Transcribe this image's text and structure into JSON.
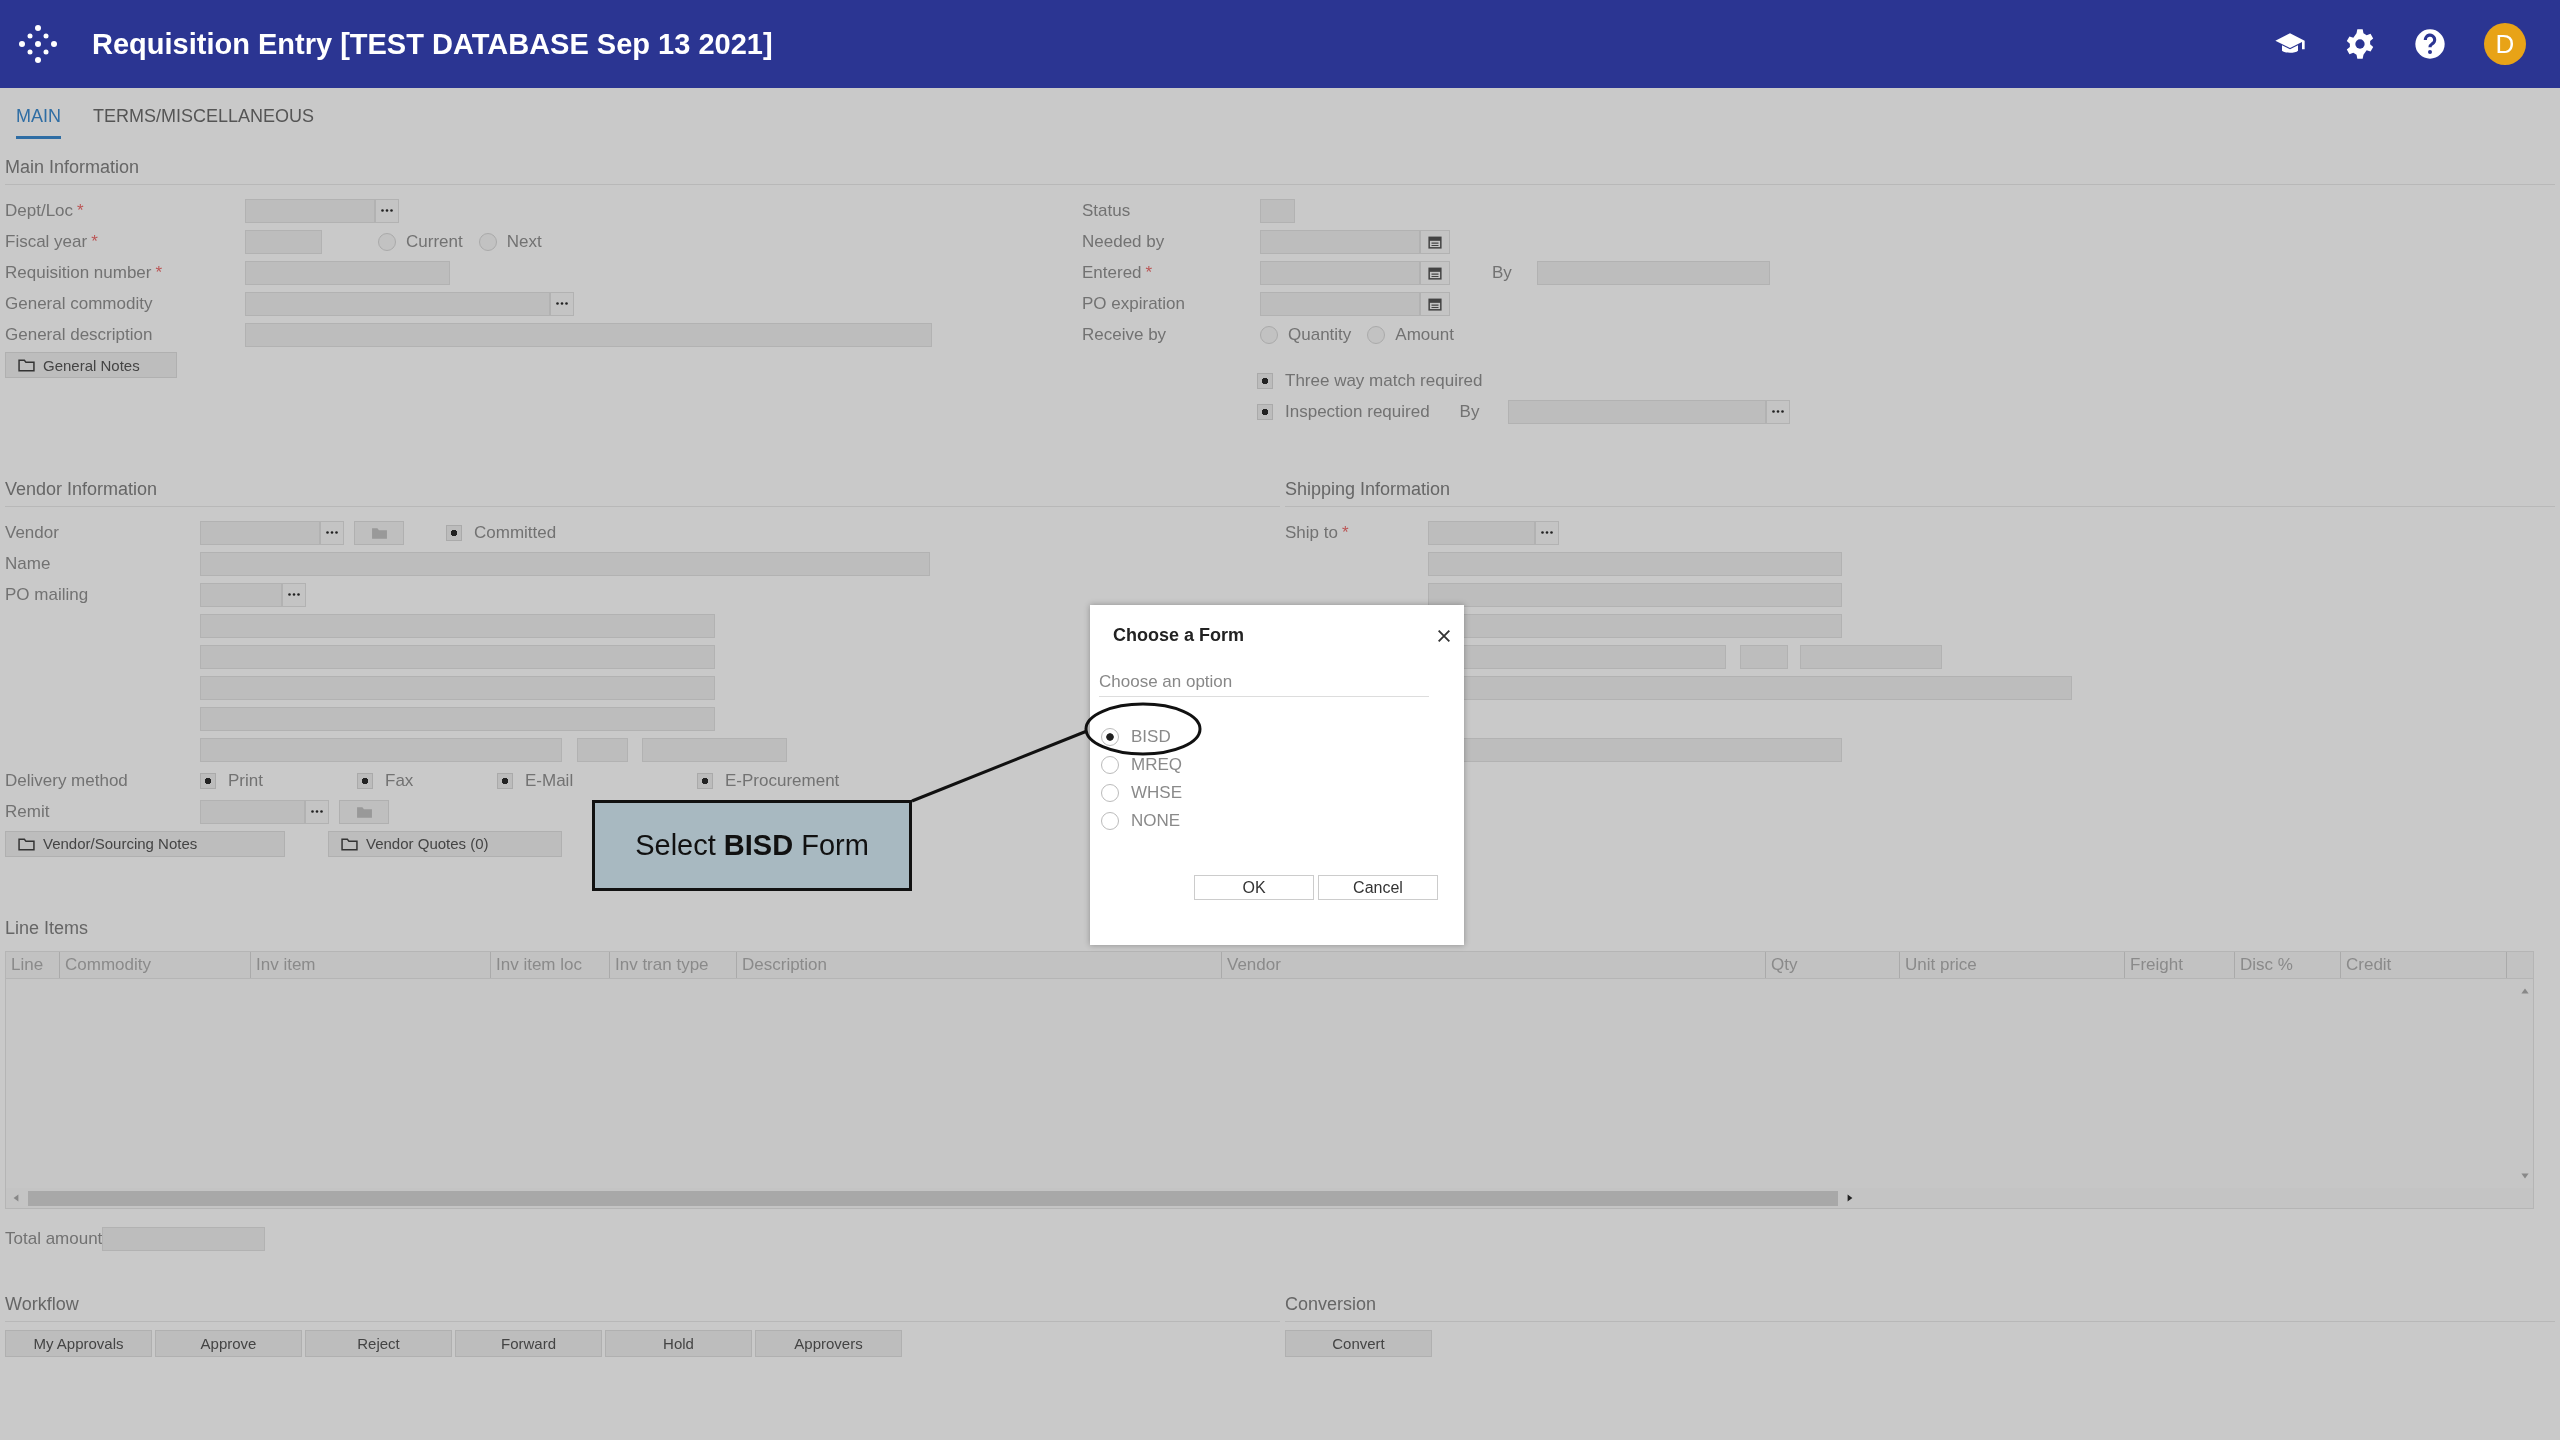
{
  "header": {
    "title": "Requisition Entry [TEST DATABASE Sep 13 2021]",
    "user_initial": "D"
  },
  "tabs": [
    {
      "label": "MAIN",
      "selected": true
    },
    {
      "label": "TERMS/MISCELLANEOUS",
      "selected": false
    }
  ],
  "main_information": {
    "title": "Main Information",
    "left_fields": [
      {
        "label": "Dept/Loc",
        "required_mark": "*",
        "kind": "lookup"
      },
      {
        "label": "Fiscal year",
        "required_mark": "*",
        "kind": "radios",
        "options": [
          {
            "label": "Current",
            "selected": false
          },
          {
            "label": "Next",
            "selected": false
          }
        ]
      },
      {
        "label": "Requisition number",
        "required_mark": "*",
        "kind": "text"
      },
      {
        "label": "General commodity",
        "kind": "lookup"
      },
      {
        "label": "General description",
        "kind": "text"
      }
    ],
    "notes_button": "General Notes",
    "right_fields": [
      {
        "label": "Status",
        "kind": "text"
      },
      {
        "label": "Needed by",
        "kind": "date"
      },
      {
        "label": "Entered",
        "required_mark": "*",
        "kind": "date",
        "by_label": "By"
      },
      {
        "label": "PO expiration",
        "kind": "date"
      },
      {
        "label": "Receive by",
        "kind": "radios",
        "options": [
          {
            "label": "Quantity",
            "selected": false
          },
          {
            "label": "Amount",
            "selected": false
          }
        ]
      }
    ],
    "checks": [
      {
        "label": "Three way match required",
        "checked": true
      },
      {
        "label": "Inspection required",
        "checked": true,
        "by_label": "By"
      }
    ]
  },
  "vendor_information": {
    "title": "Vendor Information",
    "vendor_label": "Vendor",
    "committed": {
      "label": "Committed",
      "checked": true
    },
    "name_label": "Name",
    "po_mailing_label": "PO mailing",
    "delivery_label": "Delivery method",
    "delivery_methods": [
      {
        "label": "Print",
        "checked": true
      },
      {
        "label": "Fax",
        "checked": true
      },
      {
        "label": "E-Mail",
        "checked": true
      },
      {
        "label": "E-Procurement",
        "checked": true
      }
    ],
    "remit_label": "Remit",
    "buttons": [
      "Vendor/Sourcing Notes",
      "Vendor Quotes (0)"
    ]
  },
  "shipping_information": {
    "title": "Shipping Information",
    "ship_to_label": "Ship to",
    "ship_to_required_mark": "*"
  },
  "line_items": {
    "title": "Line Items",
    "columns": [
      "Line",
      "Commodity",
      "Inv item",
      "Inv item loc",
      "Inv tran type",
      "Description",
      "Vendor",
      "Qty",
      "Unit price",
      "Freight",
      "Disc %",
      "Credit"
    ]
  },
  "total_amount_label": "Total amount",
  "workflow": {
    "title": "Workflow",
    "buttons": [
      "My Approvals",
      "Approve",
      "Reject",
      "Forward",
      "Hold",
      "Approvers"
    ]
  },
  "conversion": {
    "title": "Conversion",
    "buttons": [
      "Convert"
    ]
  },
  "dialog": {
    "title": "Choose a Form",
    "subtitle": "Choose an option",
    "options": [
      {
        "label": "BISD",
        "selected": true
      },
      {
        "label": "MREQ",
        "selected": false
      },
      {
        "label": "WHSE",
        "selected": false
      },
      {
        "label": "NONE",
        "selected": false
      }
    ],
    "buttons": [
      "OK",
      "Cancel"
    ]
  },
  "callout": {
    "text": "Select **BISD** Form"
  }
}
